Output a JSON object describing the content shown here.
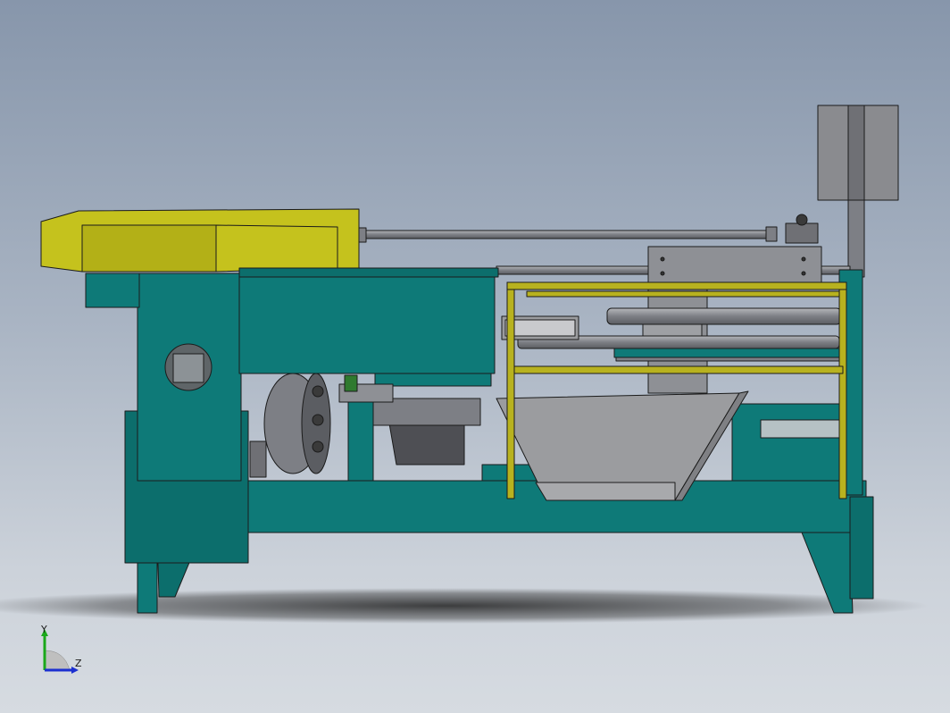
{
  "viewport": {
    "colors": {
      "frame": "#0e7a78",
      "frame_dark": "#0a5f5d",
      "hopper": "#c5c21d",
      "hopper_dark": "#9d9a14",
      "rail": "#b8b21f",
      "steel": "#7d7f85",
      "steel_light": "#a3a6ab",
      "tray": "#9b9c9f",
      "outline": "#1b1b1b"
    }
  },
  "triad": {
    "y_label": "Y",
    "z_label": "Z",
    "y_color": "#1aa81a",
    "z_color": "#1b2fd0"
  }
}
